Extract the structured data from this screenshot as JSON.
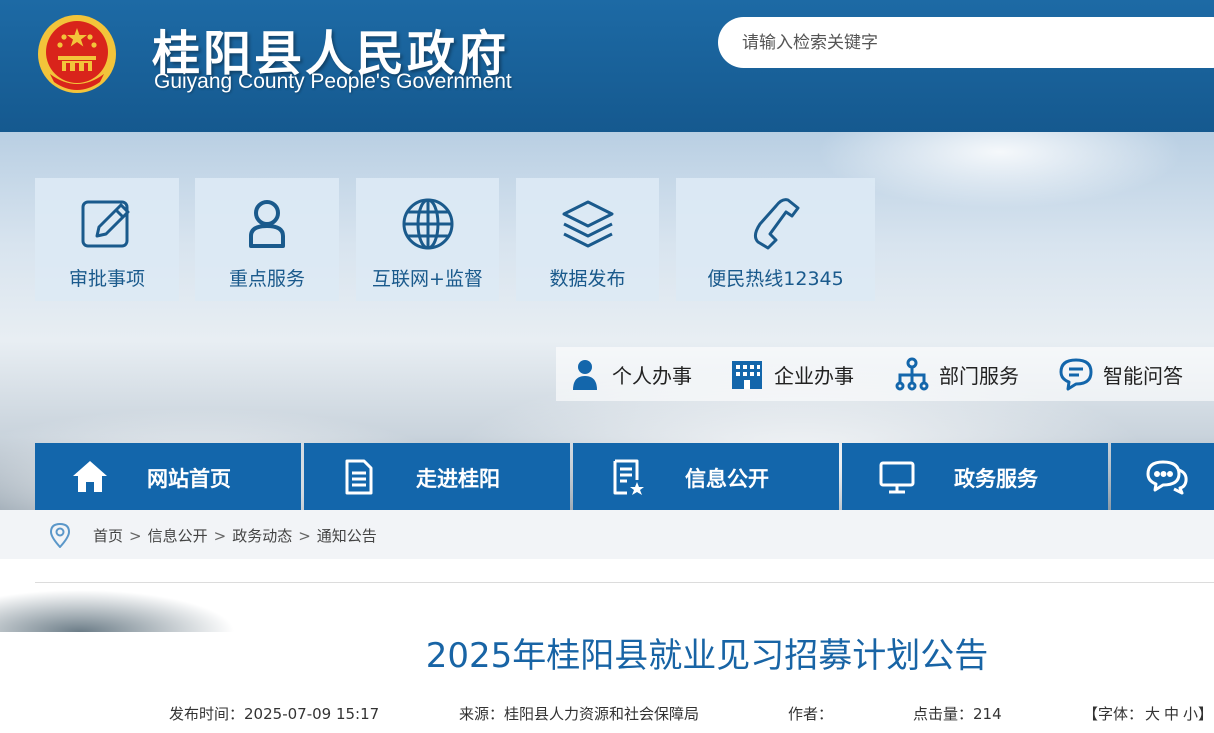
{
  "header": {
    "title": "桂阳县人民政府",
    "subtitle": "Guiyang County People's Government",
    "search_placeholder": "请输入检索关键字"
  },
  "quick_links": [
    {
      "label": "审批事项",
      "icon": "edit-icon"
    },
    {
      "label": "重点服务",
      "icon": "person-icon"
    },
    {
      "label": "互联网+监督",
      "icon": "globe-icon"
    },
    {
      "label": "数据发布",
      "icon": "layers-icon"
    },
    {
      "label": "便民热线12345",
      "icon": "phone-icon"
    }
  ],
  "services": [
    {
      "label": "个人办事",
      "icon": "user-icon"
    },
    {
      "label": "企业办事",
      "icon": "building-icon"
    },
    {
      "label": "部门服务",
      "icon": "org-chart-icon"
    },
    {
      "label": "智能问答",
      "icon": "chat-icon"
    }
  ],
  "nav": [
    {
      "label": "网站首页",
      "icon": "home-icon"
    },
    {
      "label": "走进桂阳",
      "icon": "document-icon"
    },
    {
      "label": "信息公开",
      "icon": "info-doc-icon"
    },
    {
      "label": "政务服务",
      "icon": "monitor-icon"
    },
    {
      "label": "",
      "icon": "chat-bubbles-icon"
    }
  ],
  "breadcrumb": [
    "首页",
    "信息公开",
    "政务动态",
    "通知公告"
  ],
  "breadcrumb_sep": ">",
  "article": {
    "title": "2025年桂阳县就业见习招募计划公告",
    "publish_label": "发布时间：",
    "publish_time": "2025-07-09 15:17",
    "source_label": "来源：",
    "source": "桂阳县人力资源和社会保障局",
    "author_label": "作者：",
    "author": "",
    "hits_label": "点击量：",
    "hits": "214",
    "font_label": "【字体：",
    "font_large": "大",
    "font_medium": "中",
    "font_small": "小】"
  },
  "colors": {
    "header_blue": "#15598f",
    "nav_blue": "#1366ab",
    "title_blue": "#1864a5",
    "emblem_red": "#d9241b",
    "emblem_gold": "#f3c43a"
  }
}
